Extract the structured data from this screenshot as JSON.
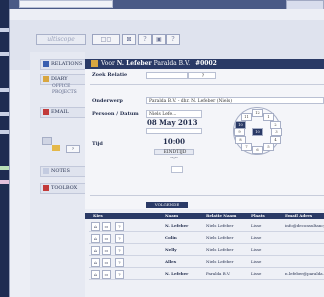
{
  "window": {
    "title_prefix": "Voor",
    "user": "N. Lefeber",
    "company": "Paralda B.V.",
    "record": "#0002"
  },
  "header": {
    "logo_text": "ultiscope",
    "tools": [
      "□◻",
      "⊠",
      "?",
      "▣",
      "?"
    ]
  },
  "nav": {
    "relations": "RELATIONS",
    "diary": "DIARY",
    "diary_sub": [
      "OFFICE",
      "PROJECTS"
    ],
    "email": "EMAIL",
    "notes": "NOTES",
    "toolbox": "TOOLBOX"
  },
  "form": {
    "zoek_relatie_label": "Zoek Relatie",
    "zoek_relatie_btn": "?",
    "onderwerp_label": "Onderwerp",
    "onderwerp_value": "Paralda B.V. - dhr. N. Lefeber (Niels)",
    "persoon_label": "Persoon / Datum",
    "persoon_value": "Niels Lefe...",
    "date_value": "08 May 2013",
    "tijd_label": "Tijd",
    "time_value": "10:00",
    "eindtijd_label": "EINDTIJD",
    "eindtijd_value": "--:--"
  },
  "clock": {
    "numbers": [
      "12",
      "1",
      "2",
      "3",
      "4",
      "5",
      "6",
      "7",
      "8",
      "9",
      "10",
      "11"
    ],
    "selected": "10"
  },
  "volgende": "VOLGENDE",
  "table": {
    "headers": [
      "Kies",
      "Naam",
      "Relatie Naam",
      "Plaats",
      "Email Adres"
    ],
    "rows": [
      {
        "naam": "N. Lefeber",
        "relatie": "Niels Lefeber",
        "plaats": "Lisse",
        "email": "info@deconsultancy"
      },
      {
        "naam": "Colin",
        "relatie": "Niels Lefeber",
        "plaats": "Lisse",
        "email": ""
      },
      {
        "naam": "Nelly",
        "relatie": "Niels Lefeber",
        "plaats": "Lisse",
        "email": ""
      },
      {
        "naam": "Allex",
        "relatie": "Niels Lefeber",
        "plaats": "Lisse",
        "email": ""
      },
      {
        "naam": "N. Lefeber",
        "relatie": "Paralda B.V.",
        "plaats": "Lisse",
        "email": "n.lefeber@paralda.nl"
      }
    ]
  },
  "colors": {
    "accent": "#2a3a66",
    "background": "#eceef5"
  }
}
